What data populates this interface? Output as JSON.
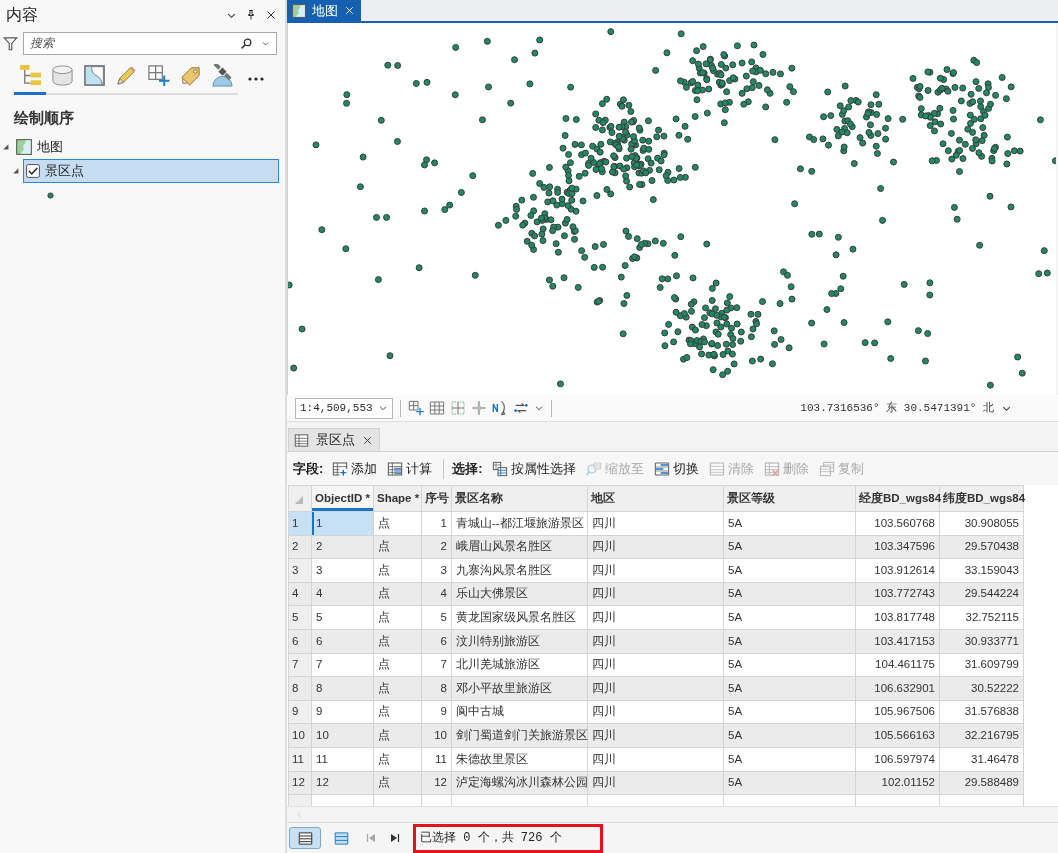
{
  "panel": {
    "title": "内容",
    "search": {
      "placeholder": "搜索"
    },
    "tools": [
      {
        "kind": "drawing-order",
        "selected": true
      },
      {
        "kind": "data-source",
        "selected": false
      },
      {
        "kind": "selection",
        "selected": false
      },
      {
        "kind": "editing",
        "selected": false
      },
      {
        "kind": "snapping",
        "selected": false
      },
      {
        "kind": "labeling",
        "selected": false
      },
      {
        "kind": "perspective",
        "selected": false
      }
    ],
    "section_title": "绘制顺序",
    "tree": [
      {
        "kind": "map",
        "label": "地图",
        "expanded": true,
        "selected": false,
        "children": [
          {
            "kind": "layer",
            "label": "景区点",
            "checked": true,
            "expanded": true,
            "selected": true
          }
        ]
      }
    ]
  },
  "map": {
    "tab": "地图",
    "scale": "1:4,509,553",
    "coordinates": "103.7316536° 东 30.5471391° 北"
  },
  "table": {
    "tab": "景区点",
    "toolbar": [
      {
        "label": "字段:",
        "buttons": [
          {
            "kind": "add",
            "label": "添加",
            "disabled": false
          },
          {
            "kind": "calculate",
            "label": "计算",
            "disabled": false
          }
        ]
      },
      {
        "label": "选择:",
        "buttons": [
          {
            "kind": "select-by-attributes",
            "label": "按属性选择",
            "disabled": false
          },
          {
            "kind": "zoom-to",
            "label": "缩放至",
            "disabled": true
          },
          {
            "kind": "switch",
            "label": "切换",
            "disabled": false
          },
          {
            "kind": "clear",
            "label": "清除",
            "disabled": true
          },
          {
            "kind": "delete",
            "label": "删除",
            "disabled": true
          },
          {
            "kind": "copy",
            "label": "复制",
            "disabled": true
          }
        ]
      }
    ],
    "columns": [
      {
        "label": "ObjectID *",
        "kind": "text",
        "selected": true
      },
      {
        "label": "Shape *",
        "kind": "text",
        "selected": false
      },
      {
        "label": "序号",
        "kind": "number",
        "selected": false
      },
      {
        "label": "景区名称",
        "kind": "text",
        "selected": false
      },
      {
        "label": "地区",
        "kind": "text",
        "selected": false
      },
      {
        "label": "景区等级",
        "kind": "text",
        "selected": false
      },
      {
        "label": "经度BD_wgs84",
        "kind": "number",
        "selected": false
      },
      {
        "label": "纬度BD_wgs84",
        "kind": "number",
        "selected": false
      }
    ],
    "rows": [
      {
        "number": "1",
        "selected": true,
        "cells": [
          "1",
          "点",
          "1",
          "青城山--都江堰旅游景区",
          "四川",
          "5A",
          "103.560768",
          "30.908055"
        ]
      },
      {
        "number": "2",
        "selected": false,
        "cells": [
          "2",
          "点",
          "2",
          "峨眉山风景名胜区",
          "四川",
          "5A",
          "103.347596",
          "29.570438"
        ]
      },
      {
        "number": "3",
        "selected": false,
        "cells": [
          "3",
          "点",
          "3",
          "九寨沟风景名胜区",
          "四川",
          "5A",
          "103.912614",
          "33.159043"
        ]
      },
      {
        "number": "4",
        "selected": false,
        "cells": [
          "4",
          "点",
          "4",
          "乐山大佛景区",
          "四川",
          "5A",
          "103.772743",
          "29.544224"
        ]
      },
      {
        "number": "5",
        "selected": false,
        "cells": [
          "5",
          "点",
          "5",
          "黄龙国家级风景名胜区",
          "四川",
          "5A",
          "103.817748",
          "32.752115"
        ]
      },
      {
        "number": "6",
        "selected": false,
        "cells": [
          "6",
          "点",
          "6",
          "汶川特别旅游区",
          "四川",
          "5A",
          "103.417153",
          "30.933771"
        ]
      },
      {
        "number": "7",
        "selected": false,
        "cells": [
          "7",
          "点",
          "7",
          "北川羌城旅游区",
          "四川",
          "5A",
          "104.461175",
          "31.609799"
        ]
      },
      {
        "number": "8",
        "selected": false,
        "cells": [
          "8",
          "点",
          "8",
          "邓小平故里旅游区",
          "四川",
          "5A",
          "106.632901",
          "30.52222"
        ]
      },
      {
        "number": "9",
        "selected": false,
        "cells": [
          "9",
          "点",
          "9",
          "阆中古城",
          "四川",
          "5A",
          "105.967506",
          "31.576838"
        ]
      },
      {
        "number": "10",
        "selected": false,
        "cells": [
          "10",
          "点",
          "10",
          "剑门蜀道剑门关旅游景区",
          "四川",
          "5A",
          "105.566163",
          "32.216795"
        ]
      },
      {
        "number": "11",
        "selected": false,
        "cells": [
          "11",
          "点",
          "11",
          "朱德故里景区",
          "四川",
          "5A",
          "106.597974",
          "31.46478"
        ]
      },
      {
        "number": "12",
        "selected": false,
        "cells": [
          "12",
          "点",
          "12",
          "泸定海螺沟冰川森林公园",
          "四川",
          "5A",
          "102.01152",
          "29.588489"
        ]
      }
    ]
  },
  "status_bar": {
    "views": [
      {
        "kind": "all-records",
        "selected": true
      },
      {
        "kind": "selected-records",
        "selected": false
      }
    ],
    "navigation": [
      {
        "kind": "first",
        "disabled": true
      },
      {
        "kind": "last",
        "disabled": false
      }
    ],
    "text": "已选择 0 个，共 726 个"
  }
}
